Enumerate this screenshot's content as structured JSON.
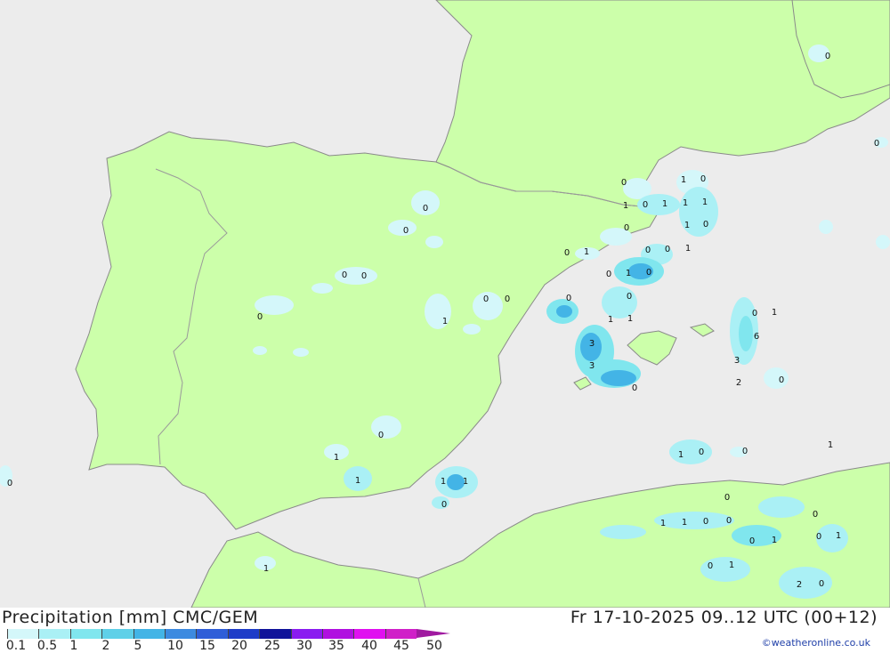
{
  "title": "Precipitation [mm] CMC/GEM",
  "datetime": "Fr 17-10-2025 09..12 UTC (00+12)",
  "credit": "©weatheronline.co.uk",
  "legend": {
    "labels": [
      "0.1",
      "0.5",
      "1",
      "2",
      "5",
      "10",
      "15",
      "20",
      "25",
      "30",
      "35",
      "40",
      "45",
      "50"
    ],
    "colors": [
      "#d4f7fa",
      "#aaf0f5",
      "#80e6ee",
      "#5fd0e8",
      "#43b4e6",
      "#3c8ae0",
      "#2f5ed8",
      "#1e3cc8",
      "#10139a",
      "#8a1cf0",
      "#b010e0",
      "#e010f0",
      "#d020c8",
      "#a01aa0"
    ]
  },
  "colors": {
    "sea": "#ececec",
    "land": "#ccffaa",
    "border": "#9a9a9a",
    "coast": "#888888"
  },
  "values": [
    {
      "t": "0"
    },
    {
      "t": "0"
    },
    {
      "t": "0"
    },
    {
      "t": "0"
    },
    {
      "t": "0"
    },
    {
      "t": "0"
    },
    {
      "t": "1"
    },
    {
      "t": "0"
    },
    {
      "t": "0"
    },
    {
      "t": "0"
    },
    {
      "t": "1"
    },
    {
      "t": "1"
    },
    {
      "t": "1"
    },
    {
      "t": "1"
    },
    {
      "t": "0"
    },
    {
      "t": "0"
    },
    {
      "t": "0"
    },
    {
      "t": "1"
    },
    {
      "t": "0"
    },
    {
      "t": "1"
    },
    {
      "t": "0"
    },
    {
      "t": "1"
    },
    {
      "t": "1"
    },
    {
      "t": "1"
    },
    {
      "t": "1"
    },
    {
      "t": "0"
    },
    {
      "t": "0"
    },
    {
      "t": "0"
    },
    {
      "t": "1"
    },
    {
      "t": "0"
    },
    {
      "t": "0"
    },
    {
      "t": "1"
    },
    {
      "t": "0"
    },
    {
      "t": "1"
    },
    {
      "t": "0"
    },
    {
      "t": "0"
    },
    {
      "t": "0"
    },
    {
      "t": "1"
    },
    {
      "t": "1"
    },
    {
      "t": "3"
    },
    {
      "t": "3"
    },
    {
      "t": "0"
    },
    {
      "t": "0"
    },
    {
      "t": "1"
    },
    {
      "t": "6"
    },
    {
      "t": "3"
    },
    {
      "t": "2"
    },
    {
      "t": "0"
    },
    {
      "t": "0"
    },
    {
      "t": "1"
    },
    {
      "t": "0"
    },
    {
      "t": "0"
    },
    {
      "t": "1"
    },
    {
      "t": "0"
    },
    {
      "t": "0"
    },
    {
      "t": "1"
    },
    {
      "t": "1"
    },
    {
      "t": "0"
    },
    {
      "t": "0"
    },
    {
      "t": "0"
    },
    {
      "t": "1"
    },
    {
      "t": "0"
    },
    {
      "t": "1"
    },
    {
      "t": "0"
    },
    {
      "t": "1"
    },
    {
      "t": "2"
    },
    {
      "t": "0"
    },
    {
      "t": "1"
    },
    {
      "t": "1"
    },
    {
      "t": "0"
    },
    {
      "t": "1"
    },
    {
      "t": "1"
    }
  ]
}
